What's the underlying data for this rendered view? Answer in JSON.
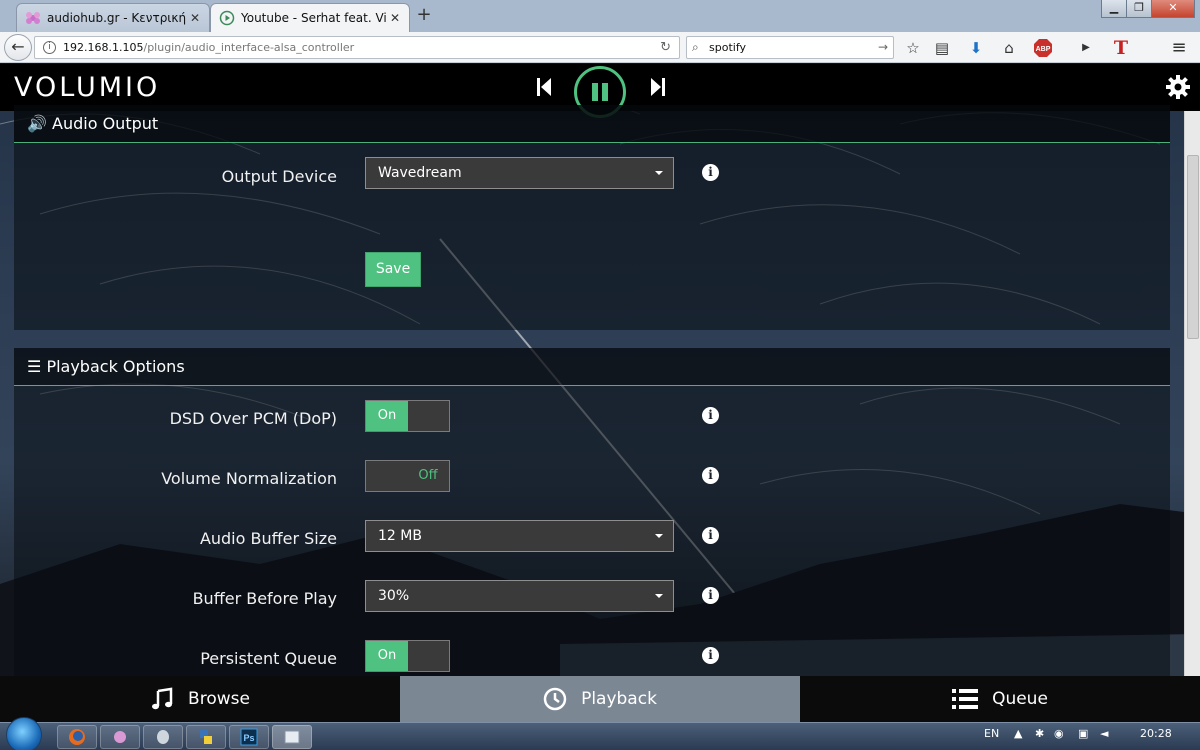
{
  "browser": {
    "tabs": [
      {
        "title": "audiohub.gr - Κεντρική σελίδ",
        "active": false
      },
      {
        "title": "Youtube - Serhat feat. Viktor",
        "active": true
      }
    ],
    "new_tab": "+",
    "window_buttons": {
      "minimize": "▁",
      "maximize": "❐",
      "close": "✕"
    },
    "url_host": "192.168.1.105",
    "url_path": "/plugin/audio_interface-alsa_controller",
    "search_value": "spotify"
  },
  "app": {
    "logo": "VOLUMIO",
    "accent_color": "#4fc180",
    "audio_output": {
      "title": "Audio Output",
      "output_device_label": "Output Device",
      "output_device_value": "Wavedream",
      "save_label": "Save"
    },
    "playback_options": {
      "title": "Playback Options",
      "dsd_label": "DSD Over PCM (DoP)",
      "dsd_state": "On",
      "volume_norm_label": "Volume Normalization",
      "volume_norm_state": "Off",
      "buffer_size_label": "Audio Buffer Size",
      "buffer_size_value": "12 MB",
      "buffer_before_label": "Buffer Before Play",
      "buffer_before_value": "30%",
      "persistent_queue_label": "Persistent Queue",
      "persistent_queue_state": "On"
    },
    "footer": {
      "browse": "Browse",
      "playback": "Playback",
      "queue": "Queue"
    }
  },
  "taskbar": {
    "language": "EN",
    "clock": "20:28"
  }
}
